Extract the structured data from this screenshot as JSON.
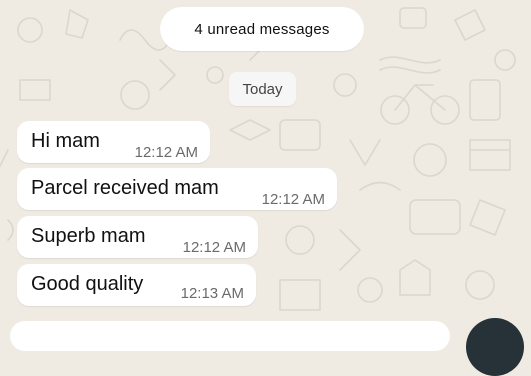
{
  "unread_banner": "4 unread messages",
  "date_separator": "Today",
  "messages": [
    {
      "text": "Hi mam",
      "time": "12:12 AM"
    },
    {
      "text": "Parcel received mam",
      "time": "12:12 AM"
    },
    {
      "text": "Superb mam",
      "time": "12:12 AM"
    },
    {
      "text": "Good quality",
      "time": "12:13 AM"
    }
  ],
  "colors": {
    "chat_background": "#efeae2",
    "bubble": "#ffffff",
    "timestamp": "#6b6b6b"
  }
}
